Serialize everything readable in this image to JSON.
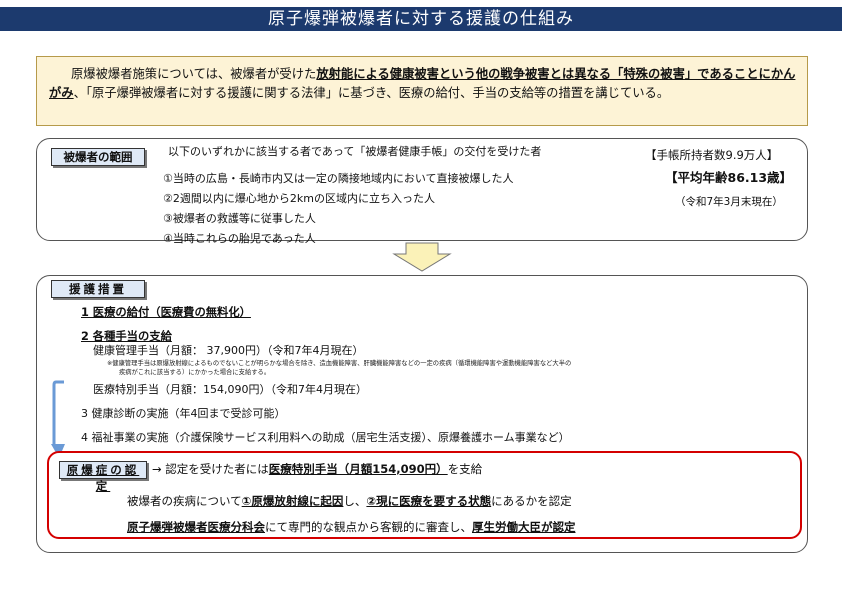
{
  "title": "原子爆弾被爆者に対する援護の仕組み",
  "intro": {
    "part1": "原爆被爆者施策については、被爆者が受けた",
    "emphasis": "放射能による健康被害という他の戦争被害とは異なる「特殊の被害」であることにかんがみ",
    "part2": "、「原子爆弾被爆者に対する援護に関する法律」に基づき、医療の給付、手当の支給等の措置を講じている。"
  },
  "scope": {
    "label": "被爆者の範囲",
    "description": "以下のいずれかに該当する者であって「被爆者健康手帳」の交付を受けた者",
    "items": [
      "①当時の広島・長崎市内又は一定の隣接地域内において直接被爆した人",
      "②2週間以内に爆心地から2kmの区域内に立ち入った人",
      "③被爆者の救護等に従事した人",
      "④当時これらの胎児であった人"
    ],
    "holders": "【手帳所持者数9.9万人】",
    "average_age": "【平均年齢86.13歳】",
    "as_of": "（令和7年3月末現在）"
  },
  "measures": {
    "label": "援護措置",
    "item1": "1 医療の給付（医療費の無料化）",
    "item2": "2 各種手当の支給",
    "allowance1": "健康管理手当（月額： 37,900円）（令和7年4月現在）",
    "note_line1": "※健康管理手当は原爆放射線によるものでないことが明らかな場合を除き、造血機能障害、肝臓機能障害などの一定の疾病（循環機能障害や運動機能障害など大半の",
    "note_line2": "疾病がこれに該当する）にかかった場合に支給する。",
    "allowance2": "医療特別手当（月額：154,090円）（令和7年4月現在）",
    "item3": "3 健康診断の実施（年4回まで受診可能）",
    "item4": "4 福祉事業の実施（介護保険サービス利用料への助成（居宅生活支援）、原爆養護ホーム事業など）"
  },
  "certification": {
    "label": "原爆症の認定",
    "arrow": "→",
    "lead": "認定を受けた者には",
    "lead_emphasis": "医療特別手当（月額154,090円）",
    "lead_tail": "を支給",
    "line2_a": "被爆者の疾病について",
    "line2_b": "①原爆放射線に起因",
    "line2_c": "し、",
    "line2_d": "②現に医療を要する状態",
    "line2_e": "にあるかを認定",
    "line3_a": "原子爆弾被爆者医療分科会",
    "line3_b": "にて専門的な観点から客観的に審査し、",
    "line3_c": "厚生労働大臣が認定"
  },
  "colors": {
    "title_bar": "#1c3a6e",
    "intro_bg": "#fdf3d6",
    "label_bg": "#dfe9f6",
    "cert_border": "#d40000",
    "arrow_fill": "#fbf2b8",
    "bracket_arrow": "#6a9ad6"
  },
  "icons": [
    "down-arrow-icon",
    "bracket-arrow-icon"
  ]
}
